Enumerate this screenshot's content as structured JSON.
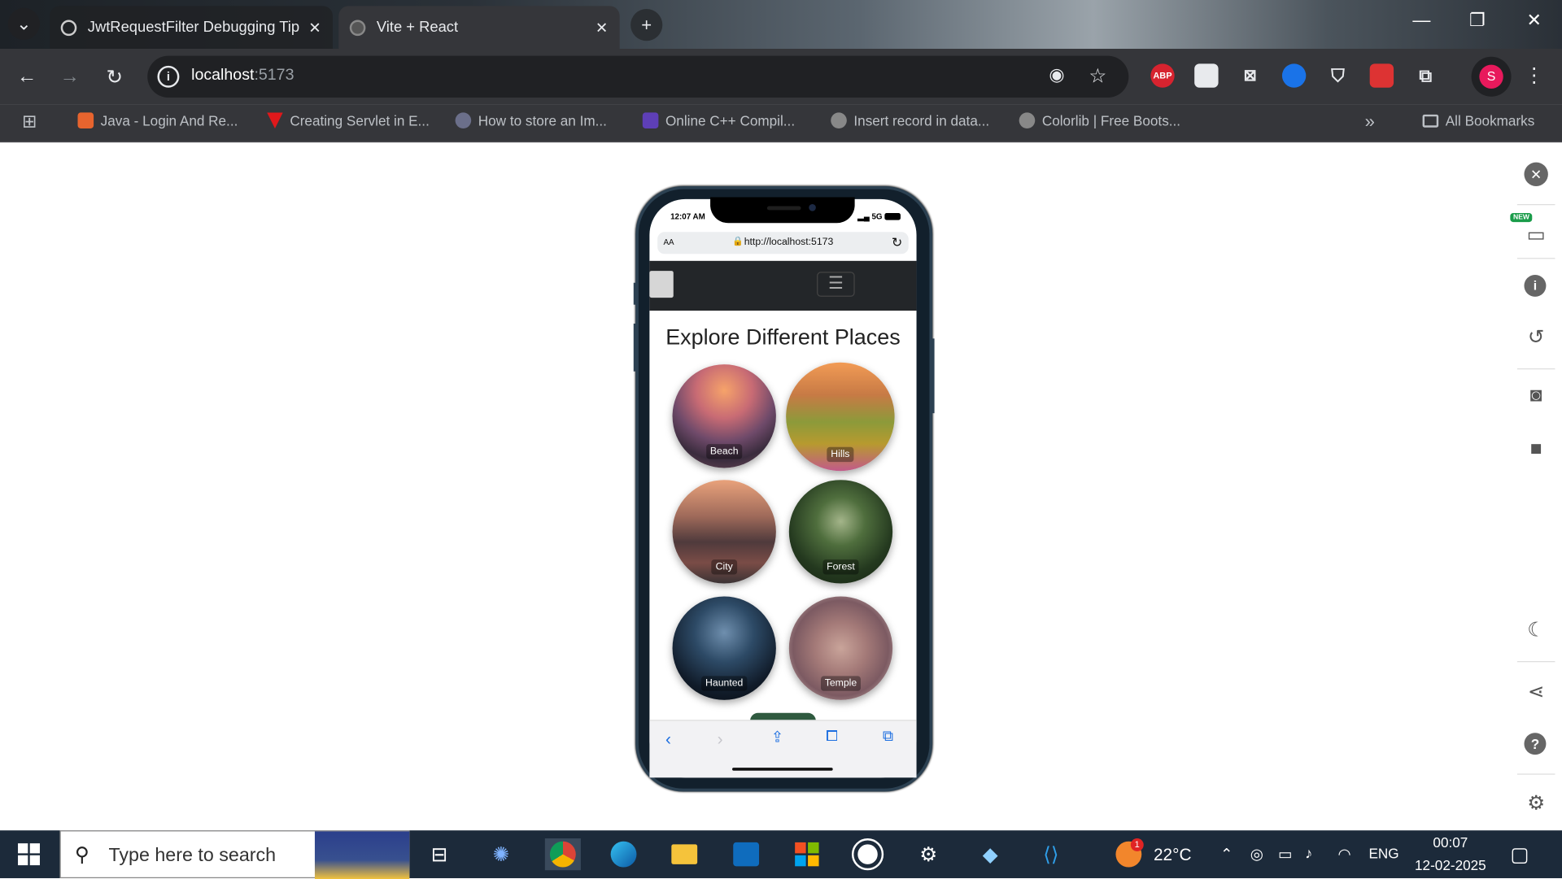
{
  "browser": {
    "tabs": [
      {
        "title": "JwtRequestFilter Debugging Tip",
        "active": false
      },
      {
        "title": "Vite + React",
        "active": true
      }
    ],
    "url_host": "localhost",
    "url_port": ":5173",
    "bookmarks": [
      "Java - Login And Re...",
      "Creating Servlet in E...",
      "How to store an Im...",
      "Online C++ Compil...",
      "Insert record in data...",
      "Colorlib | Free Boots..."
    ],
    "all_bookmarks": "All Bookmarks",
    "extensions": {
      "abp": "ABP"
    },
    "profile_initial": "S"
  },
  "device": {
    "time": "12:07 AM",
    "network": "5G",
    "text_size": "AA",
    "address": "http://localhost:5173"
  },
  "page": {
    "heading": "Explore Different Places",
    "places": [
      "Beach",
      "Hills",
      "City",
      "Forest",
      "Haunted",
      "Temple"
    ]
  },
  "devtools": {
    "new_badge": "NEW"
  },
  "taskbar": {
    "search_placeholder": "Type here to search",
    "weather": "22°C",
    "weather_badge": "1",
    "language": "ENG",
    "clock_time": "00:07",
    "clock_date": "12-02-2025"
  },
  "colors": {
    "accent_profile": "#e8195c",
    "ios_blue": "#1d6fe0"
  }
}
